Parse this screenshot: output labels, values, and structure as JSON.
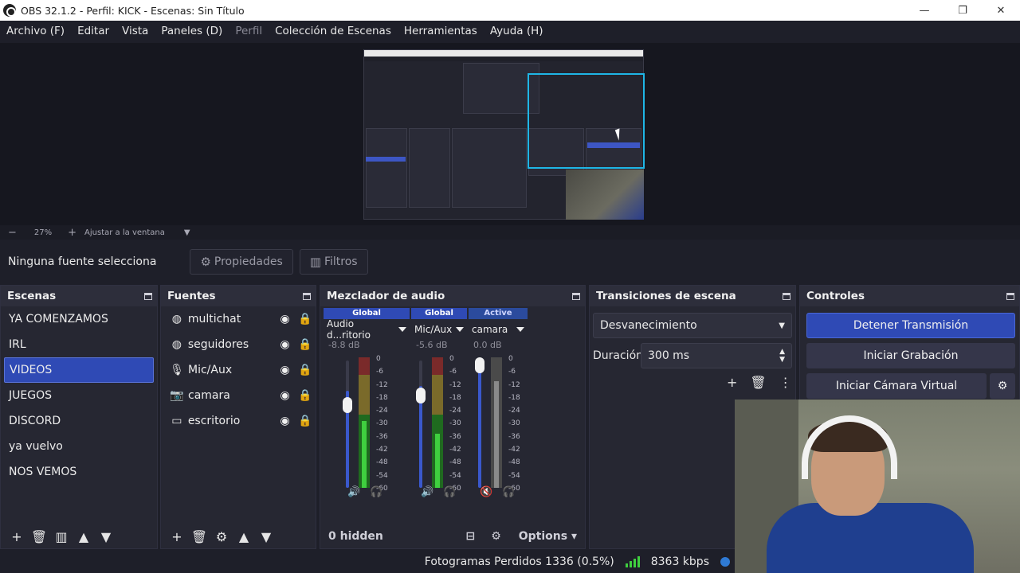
{
  "window": {
    "title": "OBS 32.1.2 - Perfil: KICK - Escenas: Sin Título",
    "minimize": "—",
    "maximize": "❐",
    "close": "✕"
  },
  "menu": [
    "Archivo (F)",
    "Editar",
    "Vista",
    "Paneles (D)",
    "Perfil",
    "Colección de Escenas",
    "Herramientas",
    "Ayuda (H)"
  ],
  "menu_disabled_index": 4,
  "zoom": {
    "minus": "−",
    "value": "27%",
    "plus": "+",
    "fit": "Ajustar a la ventana"
  },
  "source_bar": {
    "no_source": "Ninguna fuente selecciona",
    "properties": "Propiedades",
    "filters": "Filtros"
  },
  "scenes": {
    "title": "Escenas",
    "items": [
      "YA COMENZAMOS",
      "IRL",
      "VIDEOS",
      "JUEGOS",
      "DISCORD",
      "ya vuelvo",
      "NOS VEMOS"
    ],
    "selected_index": 2
  },
  "sources": {
    "title": "Fuentes",
    "items": [
      {
        "label": "multichat",
        "icon": "globe-icon"
      },
      {
        "label": "seguidores",
        "icon": "globe-icon"
      },
      {
        "label": "Mic/Aux",
        "icon": "microphone-icon"
      },
      {
        "label": "camara",
        "icon": "camera-icon"
      },
      {
        "label": "escritorio",
        "icon": "monitor-icon"
      }
    ]
  },
  "mixer": {
    "title": "Mezclador de audio",
    "channels": [
      {
        "badge": "Global",
        "name": "Audio d...ritorio",
        "db": "-8.8 dB",
        "level": 0.72,
        "muted": false
      },
      {
        "badge": "Global",
        "name": "Mic/Aux",
        "db": "-5.6 dB",
        "level": 0.8,
        "muted": false
      },
      {
        "badge": "Active",
        "name": "camara",
        "db": "0.0 dB",
        "level": 1.0,
        "muted": true
      }
    ],
    "scale": [
      "0",
      "-6",
      "-12",
      "-18",
      "-24",
      "-30",
      "-36",
      "-42",
      "-48",
      "-54",
      "-60"
    ],
    "hidden": "0 hidden",
    "options": "Options"
  },
  "transitions": {
    "title": "Transiciones de escena",
    "type": "Desvanecimiento",
    "duration_label": "Duración",
    "duration_value": "300 ms"
  },
  "controls": {
    "title": "Controles",
    "stop_stream": "Detener Transmisión",
    "start_record": "Iniciar Grabación",
    "virtual_cam": "Iniciar Cámara Virtual"
  },
  "status": {
    "dropped": "Fotogramas Perdidos 1336 (0.5%)",
    "bitrate": "8363 kbps"
  },
  "colors": {
    "accent": "#2f4ab5",
    "background": "#1e1f29",
    "dock": "#262732",
    "meter_green": "#3fcf3f",
    "meter_red": "#d83a3a"
  }
}
